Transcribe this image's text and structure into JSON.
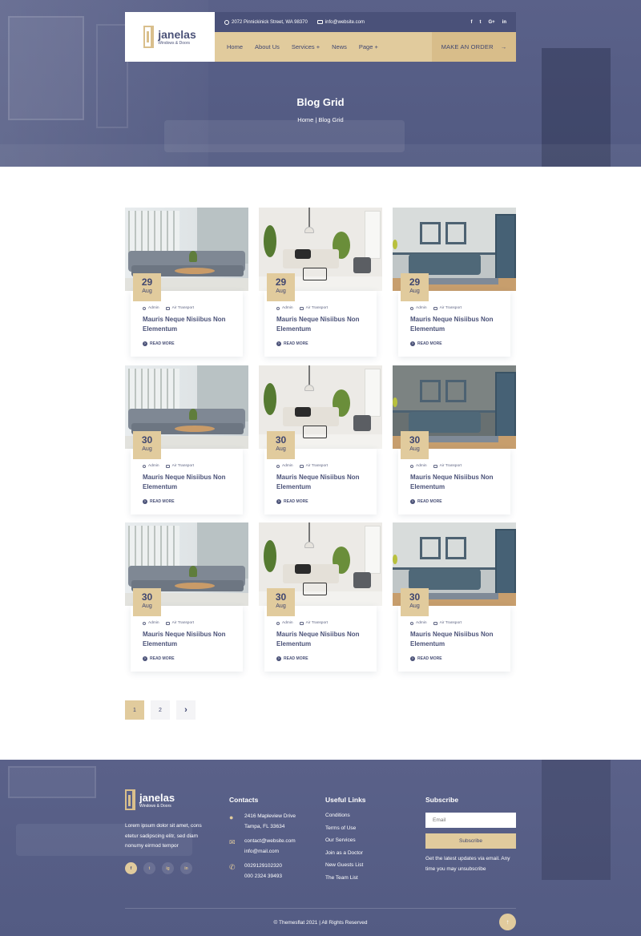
{
  "brand": {
    "name": "janelas",
    "tagline": "Windows & Doors"
  },
  "topbar": {
    "address": "2072 Pinnickinick Street, WA 98370",
    "email": "info@website.com",
    "social": [
      "f",
      "t",
      "G+",
      "in"
    ]
  },
  "nav": {
    "items": [
      "Home",
      "About Us",
      "Services +",
      "News",
      "Page +"
    ],
    "cta": "MAKE AN ORDER",
    "cta_arrow": "→"
  },
  "hero": {
    "title": "Blog Grid",
    "breadcrumb": "Home | Blog Grid"
  },
  "posts": [
    {
      "day": "29",
      "month": "Aug",
      "author": "Admin",
      "category": "Air Transport",
      "title": "Mauris Neque Nisiibus Non Elementum",
      "read_more": "READ MORE"
    },
    {
      "day": "29",
      "month": "Aug",
      "author": "Admin",
      "category": "Air Transport",
      "title": "Mauris Neque Nisiibus Non Elementum",
      "read_more": "READ MORE"
    },
    {
      "day": "29",
      "month": "Aug",
      "author": "Admin",
      "category": "Air Transport",
      "title": "Mauris Neque Nisiibus Non Elementum",
      "read_more": "READ MORE"
    },
    {
      "day": "30",
      "month": "Aug",
      "author": "Admin",
      "category": "Air Transport",
      "title": "Mauris Neque Nisiibus Non Elementum",
      "read_more": "READ MORE"
    },
    {
      "day": "30",
      "month": "Aug",
      "author": "Admin",
      "category": "Air Transport",
      "title": "Mauris Neque Nisiibus Non Elementum",
      "read_more": "READ MORE"
    },
    {
      "day": "30",
      "month": "Aug",
      "author": "Admin",
      "category": "Air Transport",
      "title": "Mauris Neque Nisiibus Non Elementum",
      "read_more": "READ MORE"
    },
    {
      "day": "30",
      "month": "Aug",
      "author": "Admin",
      "category": "Air Transport",
      "title": "Mauris Neque Nisiibus Non Elementum",
      "read_more": "READ MORE"
    },
    {
      "day": "30",
      "month": "Aug",
      "author": "Admin",
      "category": "Air Transport",
      "title": "Mauris Neque Nisiibus Non Elementum",
      "read_more": "READ MORE"
    },
    {
      "day": "30",
      "month": "Aug",
      "author": "Admin",
      "category": "Air Transport",
      "title": "Mauris Neque Nisiibus Non Elementum",
      "read_more": "READ MORE"
    }
  ],
  "pagination": {
    "pages": [
      "1",
      "2"
    ],
    "active": "1",
    "next": "›"
  },
  "footer": {
    "about": "Lorem ipsum dolor sit amet, cons etetur sadipscing elitr, sed diam nonumy eirmod tempor",
    "social": [
      "f",
      "t",
      "ig",
      "in"
    ],
    "contacts_title": "Contacts",
    "address_line1": "2416 Mapleview Drive",
    "address_line2": "Tampa, FL 33634",
    "email_line1": "contact@website.com",
    "email_line2": "info@mail.com",
    "phone_line1": "0029129102320",
    "phone_line2": "000 2324 39493",
    "links_title": "Useful Links",
    "links": [
      "Conditions",
      "Terms of Use",
      "Our Services",
      "Join as a Doctor",
      "New Guests List",
      "The Team List"
    ],
    "subscribe_title": "Subscribe",
    "email_placeholder": "Email",
    "subscribe_button": "Subscribe",
    "subscribe_note": "Get the latest updates via email. Any time you may unsubscribe",
    "copyright": "© Themesflat 2021 | All Rights Reserved",
    "back_to_top": "↑"
  },
  "colors": {
    "accent": "#e1cb9d",
    "navy": "#4b5278",
    "overlay": "#565d86"
  }
}
